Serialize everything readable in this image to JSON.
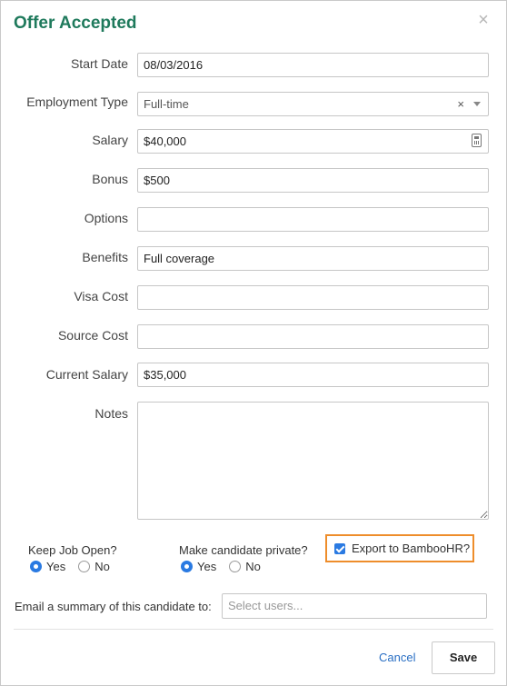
{
  "dialog": {
    "title": "Offer Accepted",
    "close_symbol": "×"
  },
  "form": {
    "start_date": {
      "label": "Start Date",
      "value": "08/03/2016"
    },
    "employment_type": {
      "label": "Employment Type",
      "value": "Full-time",
      "clear_symbol": "×"
    },
    "salary": {
      "label": "Salary",
      "value": "$40,000"
    },
    "bonus": {
      "label": "Bonus",
      "value": "$500"
    },
    "options": {
      "label": "Options",
      "value": ""
    },
    "benefits": {
      "label": "Benefits",
      "value": "Full coverage"
    },
    "visa_cost": {
      "label": "Visa Cost",
      "value": ""
    },
    "source_cost": {
      "label": "Source Cost",
      "value": ""
    },
    "current_salary": {
      "label": "Current Salary",
      "value": "$35,000"
    },
    "notes": {
      "label": "Notes",
      "value": ""
    }
  },
  "keep_job_open": {
    "label": "Keep Job Open?",
    "options": [
      "Yes",
      "No"
    ],
    "selected": "Yes"
  },
  "make_private": {
    "label": "Make candidate private?",
    "options": [
      "Yes",
      "No"
    ],
    "selected": "Yes"
  },
  "export": {
    "label": "Export to BambooHR?",
    "checked": true,
    "highlight_color": "#ee8d2b"
  },
  "email_summary": {
    "label": "Email a summary of this candidate to:",
    "placeholder": "Select users..."
  },
  "footer": {
    "cancel_label": "Cancel",
    "save_label": "Save"
  },
  "colors": {
    "title": "#1f7a5c",
    "accent": "#2a7ae2",
    "link": "#2a6fc4"
  }
}
